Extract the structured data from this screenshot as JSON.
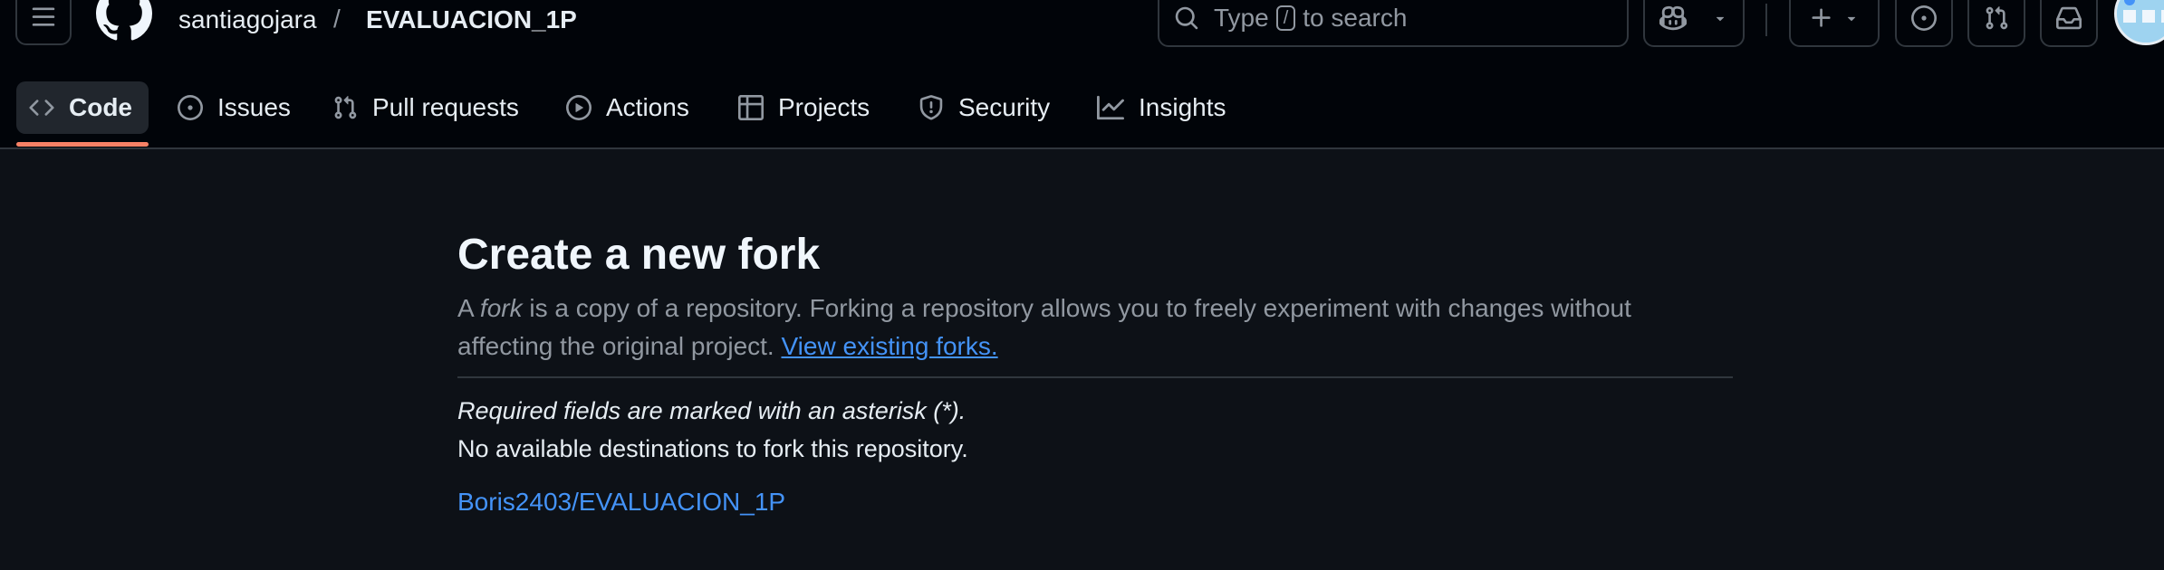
{
  "header": {
    "owner": "santiagojara",
    "separator": "/",
    "repo": "EVALUACION_1P",
    "search": {
      "prefix": "Type",
      "key": "/",
      "suffix": "to search"
    }
  },
  "nav": {
    "tabs": [
      {
        "label": "Code",
        "icon": "code-icon",
        "active": true
      },
      {
        "label": "Issues",
        "icon": "issue-opened-icon"
      },
      {
        "label": "Pull requests",
        "icon": "git-pull-request-icon"
      },
      {
        "label": "Actions",
        "icon": "play-icon"
      },
      {
        "label": "Projects",
        "icon": "table-icon"
      },
      {
        "label": "Security",
        "icon": "shield-icon"
      },
      {
        "label": "Insights",
        "icon": "graph-icon"
      }
    ]
  },
  "main": {
    "title": "Create a new fork",
    "desc_a": "A ",
    "desc_fork": "fork",
    "desc_rest": " is a copy of a repository. Forking a repository allows you to freely experiment with changes without affecting the original project. ",
    "view_forks_link": "View existing forks.",
    "required_note": "Required fields are marked with an asterisk (*).",
    "no_destinations": "No available destinations to fork this repository.",
    "parent_repo": "Boris2403/EVALUACION_1P"
  },
  "colors": {
    "background": "#0d1117",
    "header_bg": "#010409",
    "link": "#4493f8",
    "active_underline": "#f78166",
    "muted_text": "#9198a1"
  }
}
